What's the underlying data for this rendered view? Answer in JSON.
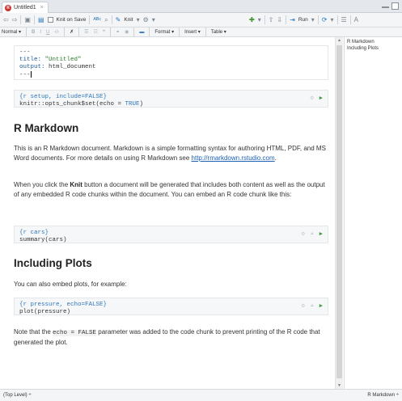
{
  "tab": {
    "icon": "R",
    "label": "Untitled1",
    "close": "×"
  },
  "toolbar1": {
    "knit_on_save": "Knit on Save",
    "knit": "Knit",
    "run": "Run"
  },
  "toolbar2": {
    "style": "Normal",
    "bold": "B",
    "italic": "I",
    "underline": "U",
    "format": "Format",
    "insert": "Insert",
    "table": "Table"
  },
  "editor": {
    "yaml": [
      "---",
      "title: \"Untitled\"",
      "output: html_document",
      "---"
    ],
    "setup_chunk": {
      "header": "{r setup, include=FALSE}",
      "line_prefix": "knitr::opts_chunk$set(echo = ",
      "line_value": "TRUE",
      "line_suffix": ")"
    },
    "h_rmarkdown": "R Markdown",
    "p1": "This is an R Markdown document. Markdown is a simple formatting syntax for authoring HTML, PDF, and MS Word documents. For more details on using R Markdown see ",
    "p1_link": "http://rmarkdown.rstudio.com",
    "p1_end": ".",
    "p2_a": "When you click the ",
    "p2_bold": "Knit",
    "p2_b": " button a document will be generated that includes both content as well as the output of any embedded R code chunks within the document. You can embed an R code chunk like this:",
    "cars_chunk": {
      "header": "{r cars}",
      "line": "summary(cars)"
    },
    "h_plots": "Including Plots",
    "p3": "You can also embed plots, for example:",
    "pressure_chunk": {
      "header": "{r pressure, echo=FALSE}",
      "line": "plot(pressure)"
    },
    "p4_a": "Note that the ",
    "p4_code": "echo = FALSE",
    "p4_b": " parameter was added to the code chunk to prevent printing of the R code that generated the plot."
  },
  "outline": [
    "R Markdown",
    "Including Plots"
  ],
  "status": {
    "left": "(Top Level) ÷",
    "right": "R Markdown ÷"
  },
  "colors": {
    "run_green": "#3e9b3e",
    "link_blue": "#1a5fb4",
    "keyword_blue": "#2e77bb"
  }
}
